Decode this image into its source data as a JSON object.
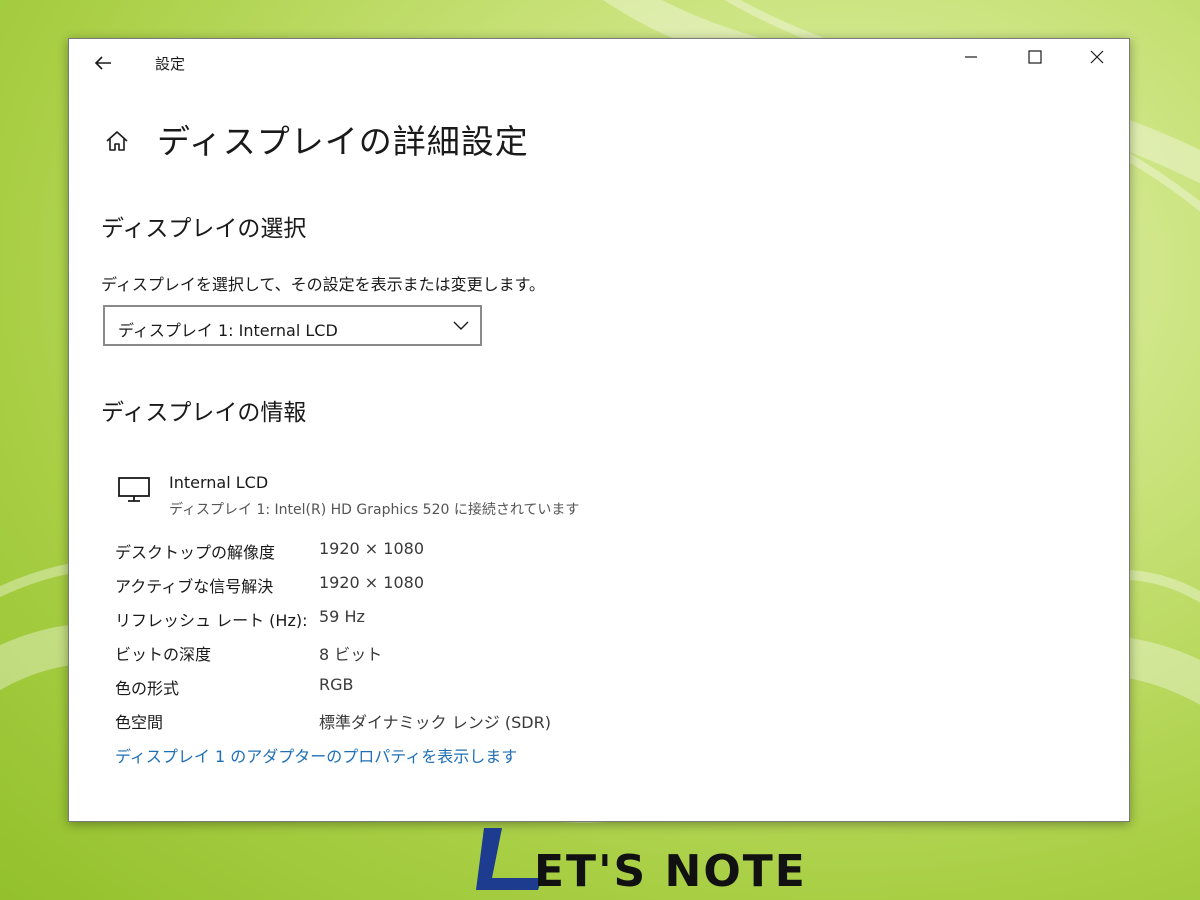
{
  "colors": {
    "link": "#1f6fb5",
    "window_bg": "#ffffff",
    "desktop_accent": "#a9cf45"
  },
  "titlebar": {
    "title": "設定",
    "back_icon": "back-arrow-icon"
  },
  "page": {
    "title": "ディスプレイの詳細設定",
    "home_icon": "home-icon"
  },
  "select_section": {
    "heading": "ディスプレイの選択",
    "description": "ディスプレイを選択して、その設定を表示または変更します。",
    "dropdown_value": "ディスプレイ 1: Internal LCD"
  },
  "info_section": {
    "heading": "ディスプレイの情報",
    "display_name": "Internal LCD",
    "display_sub": "ディスプレイ 1: Intel(R) HD Graphics 520 に接続されています",
    "rows": [
      {
        "label": "デスクトップの解像度",
        "value": "1920 × 1080"
      },
      {
        "label": "アクティブな信号解決",
        "value": "1920 × 1080"
      },
      {
        "label": "リフレッシュ レート (Hz):",
        "value": "59 Hz"
      },
      {
        "label": "ビットの深度",
        "value": "8 ビット"
      },
      {
        "label": "色の形式",
        "value": "RGB"
      },
      {
        "label": "色空間",
        "value": "標準ダイナミック レンジ (SDR)"
      }
    ],
    "adapter_link": "ディスプレイ 1 のアダプターのプロパティを表示します"
  },
  "logo": {
    "text": "LET'S NOTE"
  }
}
